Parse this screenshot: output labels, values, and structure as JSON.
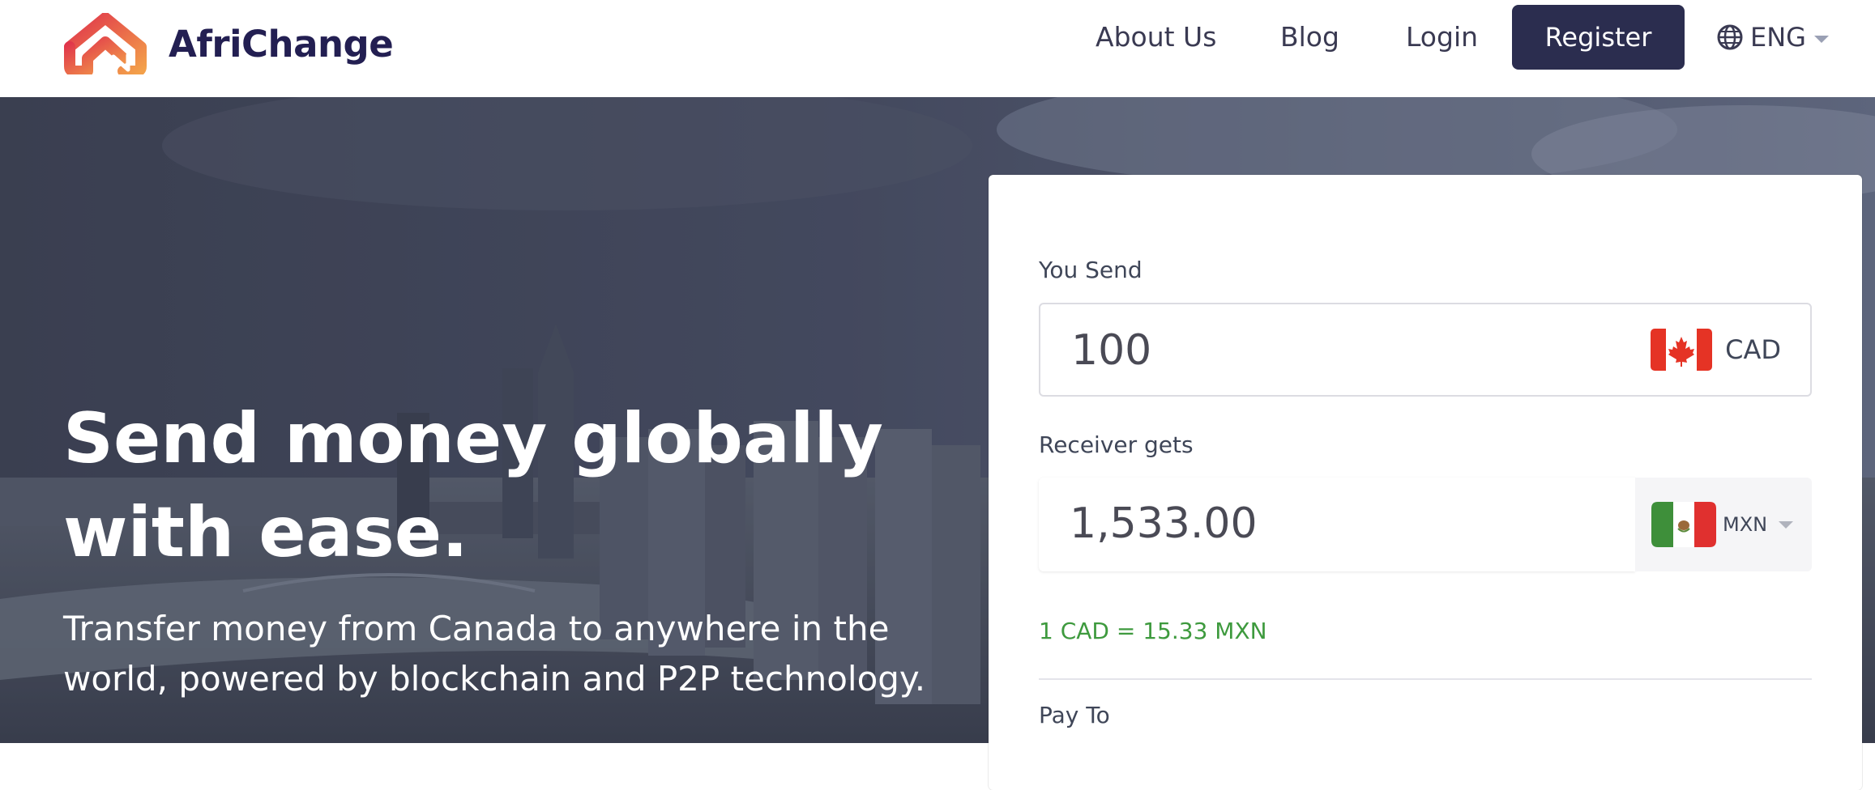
{
  "header": {
    "brand": "AfriChange",
    "nav": {
      "about": "About Us",
      "blog": "Blog",
      "login": "Login",
      "register": "Register"
    },
    "language": {
      "label": "ENG",
      "icon": "globe-icon"
    }
  },
  "hero": {
    "title": "Send money globally with ease.",
    "subtitle": "Transfer money from Canada to anywhere in the world, powered by blockchain and P2P technology."
  },
  "exchange": {
    "send_label": "You Send",
    "send_amount": "100",
    "send_currency": "CAD",
    "send_flag": "canada-flag-icon",
    "receive_label": "Receiver gets",
    "receive_amount": "1,533.00",
    "receive_currency": "MXN",
    "receive_flag": "mexico-flag-icon",
    "rate": "1 CAD = 15.33 MXN",
    "pay_to_label": "Pay To"
  },
  "colors": {
    "brand_dark": "#231f52",
    "button_dark": "#2b2d4f",
    "logo_red": "#e0344b",
    "logo_orange": "#f3a04a",
    "rate_green": "#3e9a3e"
  }
}
